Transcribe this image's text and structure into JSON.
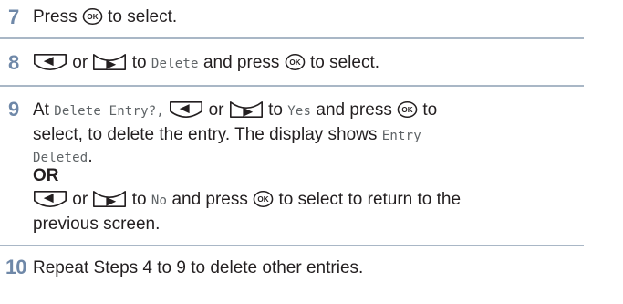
{
  "steps": [
    {
      "number": "7",
      "parts": [
        "Press",
        "to select."
      ]
    },
    {
      "number": "8",
      "parts": [
        "or",
        "to",
        "Delete",
        "and press",
        "to select."
      ]
    },
    {
      "number": "9",
      "line1": [
        "At",
        "Delete Entry?,",
        "or",
        "to",
        "Yes",
        "and press",
        "to"
      ],
      "line2": [
        "select, to delete the entry. The display shows",
        "Entry"
      ],
      "line3": [
        "Deleted",
        "."
      ],
      "or_label": "OR",
      "line5": [
        "or",
        "to",
        "No",
        "and press",
        "to select to return to the"
      ],
      "line6": "previous screen."
    },
    {
      "number": "10",
      "text": "Repeat Steps 4 to 9 to delete other entries."
    }
  ],
  "icons": {
    "ok_button": "ok-button-icon",
    "nav_left": "nav-left-button-icon",
    "nav_right": "nav-right-button-icon"
  },
  "colors": {
    "step_number": "#6f88a8",
    "rule": "#a9b7c6",
    "text": "#231f20",
    "display_text": "#5e6366"
  }
}
